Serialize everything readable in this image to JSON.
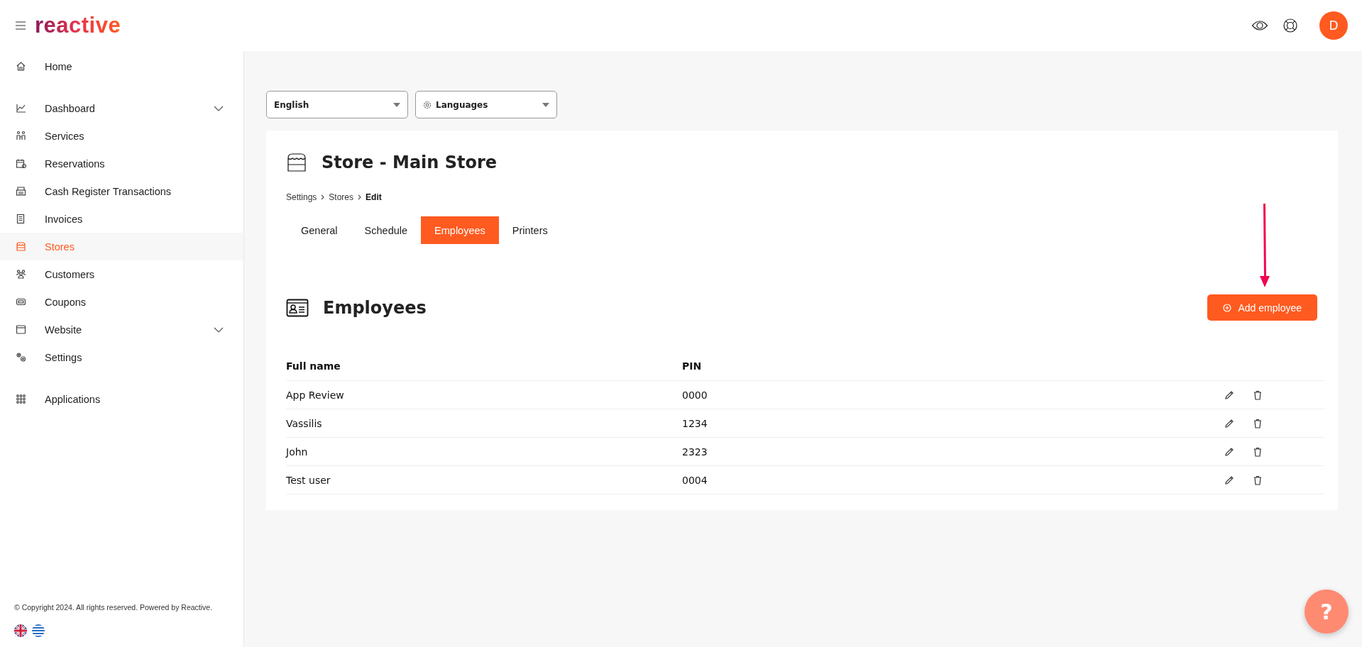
{
  "header": {
    "logo": "reactive",
    "avatar": "D"
  },
  "sidebar": {
    "sections": [
      [
        {
          "label": "Home",
          "selected": false,
          "expandable": false
        }
      ],
      [
        {
          "label": "Dashboard",
          "selected": false,
          "expandable": true
        },
        {
          "label": "Services",
          "selected": false,
          "expandable": false
        },
        {
          "label": "Reservations",
          "selected": false,
          "expandable": false
        },
        {
          "label": "Cash Register Transactions",
          "selected": false,
          "expandable": false
        },
        {
          "label": "Invoices",
          "selected": false,
          "expandable": false
        },
        {
          "label": "Stores",
          "selected": true,
          "expandable": false
        },
        {
          "label": "Customers",
          "selected": false,
          "expandable": false
        },
        {
          "label": "Coupons",
          "selected": false,
          "expandable": false
        },
        {
          "label": "Website",
          "selected": false,
          "expandable": true
        },
        {
          "label": "Settings",
          "selected": false,
          "expandable": false
        }
      ],
      [
        {
          "label": "Applications",
          "selected": false,
          "expandable": false
        }
      ]
    ],
    "copyright": "© Copyright 2024. All rights reserved. Powered by Reactive."
  },
  "selects": [
    {
      "value": "English",
      "icon": false
    },
    {
      "value": "Languages",
      "icon": true
    }
  ],
  "page": {
    "title": "Store - Main Store",
    "breadcrumb": [
      {
        "label": "Settings",
        "current": false
      },
      {
        "label": "Stores",
        "current": false
      },
      {
        "label": "Edit",
        "current": true
      }
    ],
    "tabs": [
      {
        "label": "General",
        "selected": false
      },
      {
        "label": "Schedule",
        "selected": false
      },
      {
        "label": "Employees",
        "selected": true
      },
      {
        "label": "Printers",
        "selected": false
      }
    ],
    "section_title": "Employees",
    "add_button": "Add employee",
    "table": {
      "columns": [
        "Full name",
        "PIN"
      ],
      "rows": [
        [
          "App Review",
          "0000"
        ],
        [
          "Vassilis",
          "1234"
        ],
        [
          "John",
          "2323"
        ],
        [
          "Test user",
          "0004"
        ]
      ]
    }
  },
  "help_button": "?"
}
